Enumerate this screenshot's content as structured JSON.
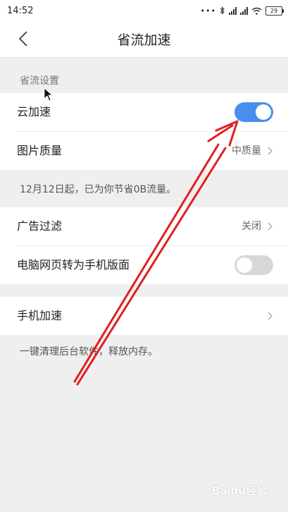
{
  "status_bar": {
    "time": "14:52",
    "dots": "•••",
    "battery": "29"
  },
  "nav": {
    "title": "省流加速"
  },
  "sections": {
    "save_header": "省流设置",
    "cloud_accel": {
      "label": "云加速",
      "toggle": "on"
    },
    "image_quality": {
      "label": "图片质量",
      "value": "中质量"
    },
    "saved_info": "12月12日起，已为你节省0B流量。",
    "ad_filter": {
      "label": "广告过滤",
      "value": "关闭"
    },
    "pc_to_mobile": {
      "label": "电脑网页转为手机版面",
      "toggle": "off"
    },
    "phone_accel": {
      "label": "手机加速"
    },
    "phone_accel_hint": "一键清理后台软件，释放内存。"
  },
  "watermark": "Baidu经验",
  "colors": {
    "toggle_on": "#4a8df0",
    "toggle_off": "#d7d7d7",
    "annotation_arrow": "#e02020"
  }
}
